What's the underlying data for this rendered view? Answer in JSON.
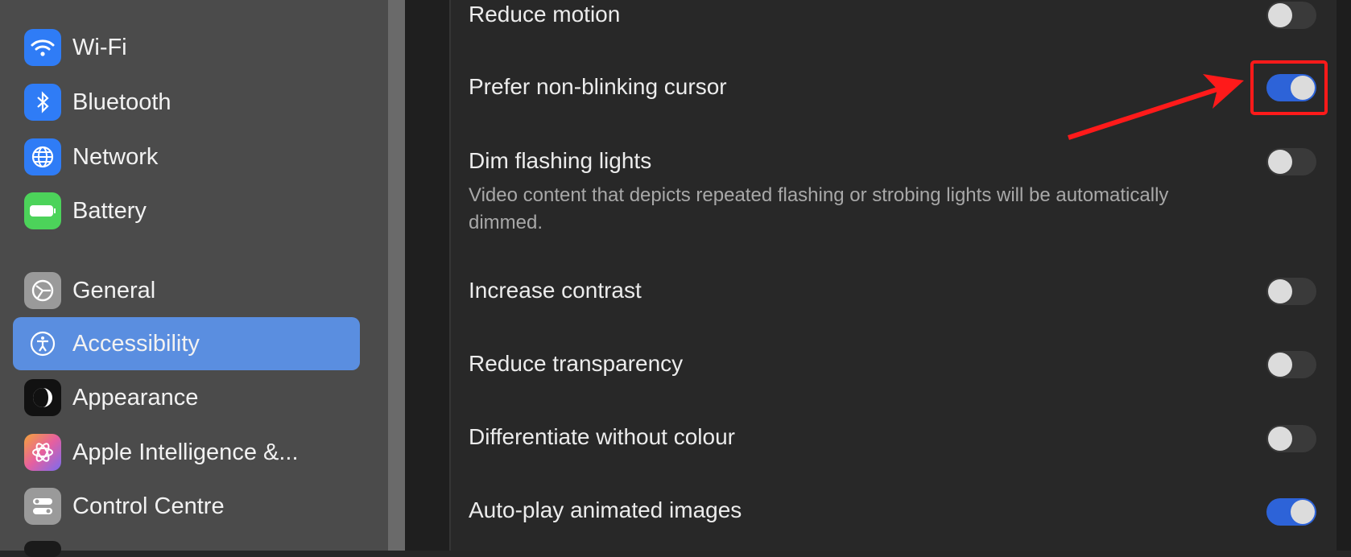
{
  "sidebar": {
    "items": [
      {
        "label": "Wi-Fi",
        "icon": "wifi-icon",
        "color": "#2f7cf6"
      },
      {
        "label": "Bluetooth",
        "icon": "bluetooth-icon",
        "color": "#2f7cf6"
      },
      {
        "label": "Network",
        "icon": "globe-icon",
        "color": "#2f7cf6"
      },
      {
        "label": "Battery",
        "icon": "battery-icon",
        "color": "#4cd35a"
      },
      {
        "label": "General",
        "icon": "gear-icon",
        "color": "#9a9a9a"
      },
      {
        "label": "Accessibility",
        "icon": "accessibility-icon",
        "color": "#5a8ee0",
        "active": true
      },
      {
        "label": "Appearance",
        "icon": "appearance-icon",
        "color": "#111111"
      },
      {
        "label": "Apple Intelligence &...",
        "icon": "apple-intelligence-icon",
        "color": "#e55fa0"
      },
      {
        "label": "Control Centre",
        "icon": "control-centre-icon",
        "color": "#9a9a9a"
      }
    ]
  },
  "settings": [
    {
      "label": "Reduce motion",
      "on": false
    },
    {
      "label": "Prefer non-blinking cursor",
      "on": true,
      "highlighted": true
    },
    {
      "label": "Dim flashing lights",
      "on": false,
      "description": "Video content that depicts repeated flashing or strobing lights will be automatically dimmed."
    },
    {
      "label": "Increase contrast",
      "on": false
    },
    {
      "label": "Reduce transparency",
      "on": false
    },
    {
      "label": "Differentiate without colour",
      "on": false
    },
    {
      "label": "Auto-play animated images",
      "on": true
    }
  ],
  "colors": {
    "accent": "#2d63d8",
    "annotation": "#ff1a1a",
    "selection": "#5a8ee0"
  }
}
